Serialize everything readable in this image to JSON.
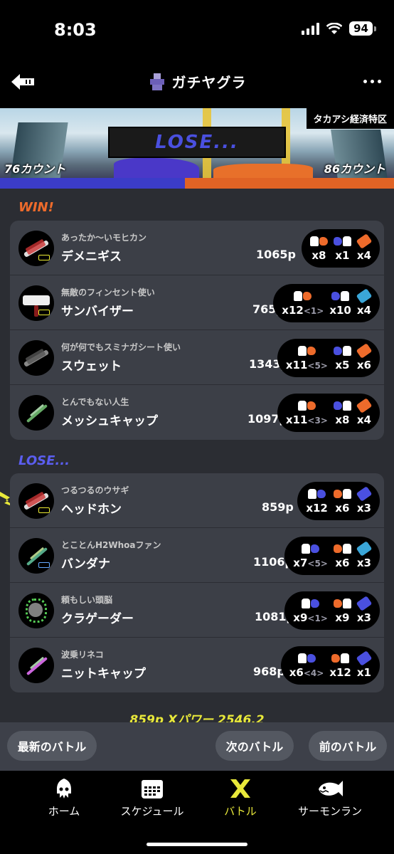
{
  "status": {
    "time": "8:03",
    "battery": "94"
  },
  "nav": {
    "title": "ガチヤグラ"
  },
  "banner": {
    "stage": "タカアシ経済特区",
    "result": "LOSE...",
    "left_count": "76カウント",
    "right_count": "86カウント"
  },
  "colors": {
    "win": "#ee6b2b",
    "lose": "#4a50e0",
    "accent": "#e8e83a"
  },
  "win_label": "WIN!",
  "lose_label": "LOSE...",
  "score_bar": {
    "blue_fraction": 0.469
  },
  "win_team": [
    {
      "title": "あったか～いモヒカン",
      "name": "デメニギス",
      "points": "1065p",
      "kills": "x8",
      "specials": "x1",
      "sub_count": "x4",
      "assist": ""
    },
    {
      "title": "無敵のフィンセント使い",
      "name": "サンバイザー",
      "points": "765p",
      "kills": "x12",
      "specials": "x10",
      "sub_count": "x4",
      "assist": "<1>"
    },
    {
      "title": "何が何でもスミナガシート使い",
      "name": "スウェット",
      "points": "1343p",
      "kills": "x11",
      "specials": "x5",
      "sub_count": "x6",
      "assist": "<5>"
    },
    {
      "title": "とんでもない人生",
      "name": "メッシュキャップ",
      "points": "1097p",
      "kills": "x11",
      "specials": "x8",
      "sub_count": "x4",
      "assist": "<3>"
    }
  ],
  "lose_team": [
    {
      "title": "つるつるのウサギ",
      "name": "ヘッドホン",
      "points": "859p",
      "kills": "x12",
      "specials": "x6",
      "sub_count": "x3",
      "assist": ""
    },
    {
      "title": "とことんH2Whoaファン",
      "name": "バンダナ",
      "points": "1106p",
      "kills": "x7",
      "specials": "x6",
      "sub_count": "x3",
      "assist": "<5>"
    },
    {
      "title": "頼もしい頭脳",
      "name": "クラゲーダー",
      "points": "1081p",
      "kills": "x9",
      "specials": "x9",
      "sub_count": "x3",
      "assist": "<1>"
    },
    {
      "title": "波乗リネコ",
      "name": "ニットキャップ",
      "points": "968p",
      "kills": "x6",
      "specials": "x12",
      "sub_count": "x1",
      "assist": "<4>"
    }
  ],
  "footer_text": "859p Xパワー 2546.2",
  "buttons": {
    "latest": "最新のバトル",
    "next": "次のバトル",
    "prev": "前のバトル"
  },
  "tabs": [
    {
      "label": "ホーム",
      "icon": "squid-icon"
    },
    {
      "label": "スケジュール",
      "icon": "calendar-icon"
    },
    {
      "label": "バトル",
      "icon": "battle-icon"
    },
    {
      "label": "サーモンラン",
      "icon": "salmon-icon"
    }
  ]
}
